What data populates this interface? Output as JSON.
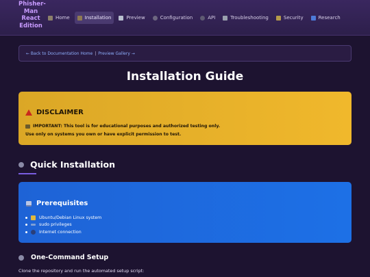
{
  "app": {
    "brand": "Phisher-Man React Edition"
  },
  "nav": {
    "items": [
      {
        "label": "Home",
        "icon": "home-icon"
      },
      {
        "label": "Installation",
        "icon": "package-icon",
        "active": true
      },
      {
        "label": "Preview",
        "icon": "document-icon"
      },
      {
        "label": "Configuration",
        "icon": "gear-icon"
      },
      {
        "label": "API",
        "icon": "star-icon"
      },
      {
        "label": "Troubleshooting",
        "icon": "wrench-icon"
      },
      {
        "label": "Security",
        "icon": "lock-icon"
      },
      {
        "label": "Research",
        "icon": "book-icon"
      }
    ]
  },
  "breadcrumb": {
    "back_home": "← Back to Documentation Home",
    "separator": "|",
    "preview_gallery": "Preview Gallery →"
  },
  "page": {
    "title": "Installation Guide"
  },
  "disclaimer": {
    "heading": "DISCLAIMER",
    "line1": "IMPORTANT: This tool is for educational purposes and authorized testing only.",
    "line2": "Use only on systems you own or have explicit permission to test."
  },
  "quick": {
    "heading": "Quick Installation"
  },
  "prereq": {
    "heading": "Prerequisites",
    "items": [
      {
        "label": "Ubuntu/Debian Linux system",
        "icon": "linux-icon"
      },
      {
        "label": "sudo privileges",
        "icon": "key-icon"
      },
      {
        "label": "Internet connection",
        "icon": "globe-icon"
      }
    ]
  },
  "setup": {
    "heading": "One-Command Setup",
    "text": "Clone the repository and run the automated setup script:"
  },
  "colors": {
    "background": "#1d1330",
    "topbar": "#2d1f4b",
    "brand": "#c89bff",
    "disclaimer_bg": "#f0b82c",
    "prereq_bg": "#1d6ce2",
    "link": "#8fb0ff"
  }
}
